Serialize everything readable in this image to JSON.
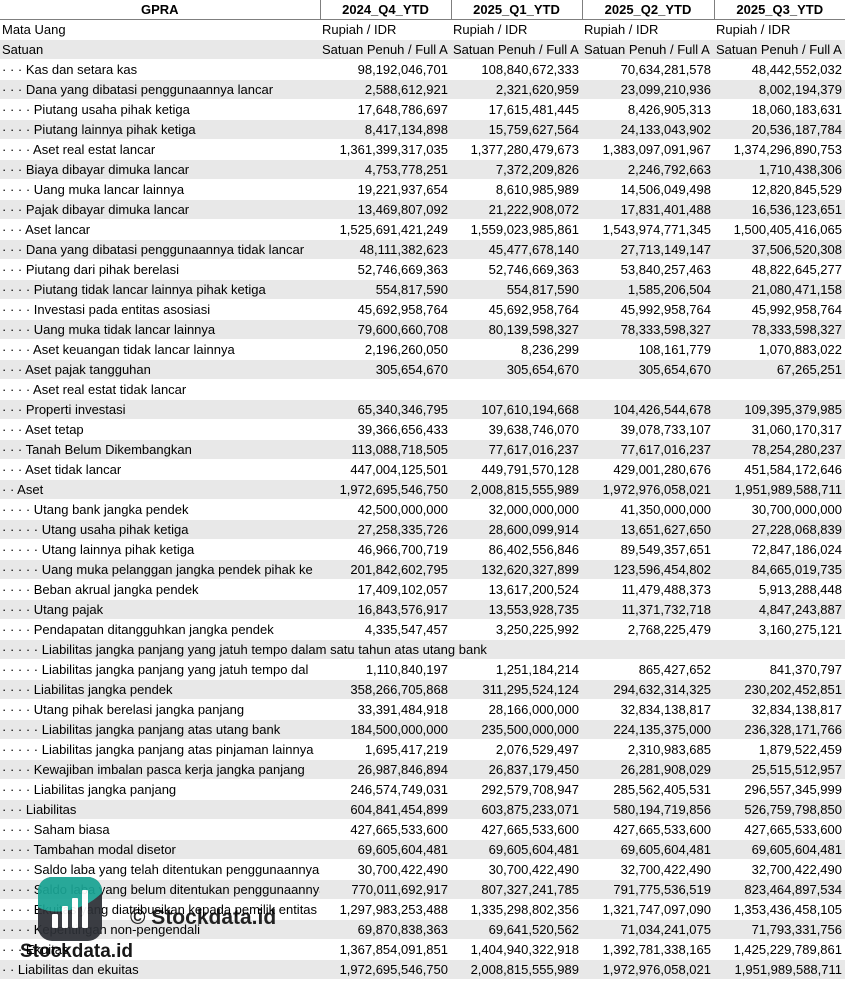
{
  "header": {
    "label": "GPRA",
    "periods": [
      "2024_Q4_YTD",
      "2025_Q1_YTD",
      "2025_Q2_YTD",
      "2025_Q3_YTD"
    ]
  },
  "meta_rows": [
    {
      "label": "Mata Uang",
      "values": [
        "Rupiah / IDR",
        "Rupiah / IDR",
        "Rupiah / IDR",
        "Rupiah / IDR"
      ]
    },
    {
      "label": "Satuan",
      "values": [
        "Satuan Penuh / Full A",
        "Satuan Penuh / Full A",
        "Satuan Penuh / Full A",
        "Satuan Penuh / Full A"
      ]
    }
  ],
  "rows": [
    {
      "indent": "· · · ",
      "label": "Kas dan setara kas",
      "values": [
        "98,192,046,701",
        "108,840,672,333",
        "70,634,281,578",
        "48,442,552,032"
      ]
    },
    {
      "indent": "· · · ",
      "label": "Dana yang dibatasi penggunaannya lancar",
      "values": [
        "2,588,612,921",
        "2,321,620,959",
        "23,099,210,936",
        "8,002,194,379"
      ]
    },
    {
      "indent": "· · · · ",
      "label": "Piutang usaha pihak ketiga",
      "values": [
        "17,648,786,697",
        "17,615,481,445",
        "8,426,905,313",
        "18,060,183,631"
      ]
    },
    {
      "indent": "· · · · ",
      "label": "Piutang lainnya pihak ketiga",
      "values": [
        "8,417,134,898",
        "15,759,627,564",
        "24,133,043,902",
        "20,536,187,784"
      ]
    },
    {
      "indent": "· · · · ",
      "label": "Aset real estat lancar",
      "values": [
        "1,361,399,317,035",
        "1,377,280,479,673",
        "1,383,097,091,967",
        "1,374,296,890,753"
      ]
    },
    {
      "indent": "· · · ",
      "label": "Biaya dibayar dimuka lancar",
      "values": [
        "4,753,778,251",
        "7,372,209,826",
        "2,246,792,663",
        "1,710,438,306"
      ]
    },
    {
      "indent": "· · · · ",
      "label": "Uang muka lancar lainnya",
      "values": [
        "19,221,937,654",
        "8,610,985,989",
        "14,506,049,498",
        "12,820,845,529"
      ]
    },
    {
      "indent": "· · · ",
      "label": "Pajak dibayar dimuka lancar",
      "values": [
        "13,469,807,092",
        "21,222,908,072",
        "17,831,401,488",
        "16,536,123,651"
      ]
    },
    {
      "indent": "· · · ",
      "label": "Aset lancar",
      "values": [
        "1,525,691,421,249",
        "1,559,023,985,861",
        "1,543,974,771,345",
        "1,500,405,416,065"
      ]
    },
    {
      "indent": "· · · ",
      "label": "Dana yang dibatasi penggunaannya tidak lancar",
      "values": [
        "48,111,382,623",
        "45,477,678,140",
        "27,713,149,147",
        "37,506,520,308"
      ]
    },
    {
      "indent": "· · · ",
      "label": "Piutang dari pihak berelasi",
      "values": [
        "52,746,669,363",
        "52,746,669,363",
        "53,840,257,463",
        "48,822,645,277"
      ]
    },
    {
      "indent": "· · · · ",
      "label": "Piutang tidak lancar lainnya pihak ketiga",
      "values": [
        "554,817,590",
        "554,817,590",
        "1,585,206,504",
        "21,080,471,158"
      ]
    },
    {
      "indent": "· · · · ",
      "label": "Investasi pada entitas asosiasi",
      "values": [
        "45,692,958,764",
        "45,692,958,764",
        "45,992,958,764",
        "45,992,958,764"
      ]
    },
    {
      "indent": "· · · · ",
      "label": "Uang muka tidak lancar lainnya",
      "values": [
        "79,600,660,708",
        "80,139,598,327",
        "78,333,598,327",
        "78,333,598,327"
      ]
    },
    {
      "indent": "· · · · ",
      "label": "Aset keuangan tidak lancar lainnya",
      "values": [
        "2,196,260,050",
        "8,236,299",
        "108,161,779",
        "1,070,883,022"
      ]
    },
    {
      "indent": "· · · ",
      "label": "Aset pajak tangguhan",
      "values": [
        "305,654,670",
        "305,654,670",
        "305,654,670",
        "67,265,251"
      ]
    },
    {
      "indent": "· · · · ",
      "label": "Aset real estat tidak lancar",
      "values": [
        "",
        "",
        "",
        ""
      ]
    },
    {
      "indent": "· · · ",
      "label": "Properti investasi",
      "values": [
        "65,340,346,795",
        "107,610,194,668",
        "104,426,544,678",
        "109,395,379,985"
      ]
    },
    {
      "indent": "· · · ",
      "label": "Aset tetap",
      "values": [
        "39,366,656,433",
        "39,638,746,070",
        "39,078,733,107",
        "31,060,170,317"
      ]
    },
    {
      "indent": "· · · ",
      "label": "Tanah Belum Dikembangkan",
      "values": [
        "113,088,718,505",
        "77,617,016,237",
        "77,617,016,237",
        "78,254,280,237"
      ]
    },
    {
      "indent": "· · · ",
      "label": "Aset tidak lancar",
      "values": [
        "447,004,125,501",
        "449,791,570,128",
        "429,001,280,676",
        "451,584,172,646"
      ]
    },
    {
      "indent": "· · ",
      "label": "Aset",
      "values": [
        "1,972,695,546,750",
        "2,008,815,555,989",
        "1,972,976,058,021",
        "1,951,989,588,711"
      ]
    },
    {
      "indent": "· · · · ",
      "label": "Utang bank jangka pendek",
      "values": [
        "42,500,000,000",
        "32,000,000,000",
        "41,350,000,000",
        "30,700,000,000"
      ]
    },
    {
      "indent": "· · · · · ",
      "label": "Utang usaha pihak ketiga",
      "values": [
        "27,258,335,726",
        "28,600,099,914",
        "13,651,627,650",
        "27,228,068,839"
      ]
    },
    {
      "indent": "· · · · · ",
      "label": "Utang lainnya pihak ketiga",
      "values": [
        "46,966,700,719",
        "86,402,556,846",
        "89,549,357,651",
        "72,847,186,024"
      ]
    },
    {
      "indent": "· · · · · ",
      "label": "Uang muka pelanggan jangka pendek pihak ke",
      "values": [
        "201,842,602,795",
        "132,620,327,899",
        "123,596,454,802",
        "84,665,019,735"
      ]
    },
    {
      "indent": "· · · · ",
      "label": "Beban akrual jangka pendek",
      "values": [
        "17,409,102,057",
        "13,617,200,524",
        "11,479,488,373",
        "5,913,288,448"
      ]
    },
    {
      "indent": "· · · · ",
      "label": "Utang pajak",
      "values": [
        "16,843,576,917",
        "13,553,928,735",
        "11,371,732,718",
        "4,847,243,887"
      ]
    },
    {
      "indent": "· · · · ",
      "label": "Pendapatan ditangguhkan jangka pendek",
      "values": [
        "4,335,547,457",
        "3,250,225,992",
        "2,768,225,479",
        "3,160,275,121"
      ]
    },
    {
      "indent": "· · · · · ",
      "label": "Liabilitas jangka panjang yang jatuh tempo dalam satu tahun atas utang bank",
      "values": [
        "",
        "",
        "",
        ""
      ],
      "span": true
    },
    {
      "indent": "· · · · · ",
      "label": "Liabilitas jangka panjang yang jatuh tempo dal",
      "values": [
        "1,110,840,197",
        "1,251,184,214",
        "865,427,652",
        "841,370,797"
      ]
    },
    {
      "indent": "· · · · ",
      "label": "Liabilitas jangka pendek",
      "values": [
        "358,266,705,868",
        "311,295,524,124",
        "294,632,314,325",
        "230,202,452,851"
      ]
    },
    {
      "indent": "· · · · ",
      "label": "Utang pihak berelasi jangka panjang",
      "values": [
        "33,391,484,918",
        "28,166,000,000",
        "32,834,138,817",
        "32,834,138,817"
      ]
    },
    {
      "indent": "· · · · · ",
      "label": "Liabilitas jangka panjang atas utang bank",
      "values": [
        "184,500,000,000",
        "235,500,000,000",
        "224,135,375,000",
        "236,328,171,766"
      ]
    },
    {
      "indent": "· · · · · ",
      "label": "Liabilitas jangka panjang atas pinjaman lainnya",
      "values": [
        "1,695,417,219",
        "2,076,529,497",
        "2,310,983,685",
        "1,879,522,459"
      ]
    },
    {
      "indent": "· · · · ",
      "label": "Kewajiban imbalan pasca kerja jangka panjang",
      "values": [
        "26,987,846,894",
        "26,837,179,450",
        "26,281,908,029",
        "25,515,512,957"
      ]
    },
    {
      "indent": "· · · · ",
      "label": "Liabilitas jangka panjang",
      "values": [
        "246,574,749,031",
        "292,579,708,947",
        "285,562,405,531",
        "296,557,345,999"
      ]
    },
    {
      "indent": "· · · ",
      "label": "Liabilitas",
      "values": [
        "604,841,454,899",
        "603,875,233,071",
        "580,194,719,856",
        "526,759,798,850"
      ]
    },
    {
      "indent": "· · · · ",
      "label": "Saham biasa",
      "values": [
        "427,665,533,600",
        "427,665,533,600",
        "427,665,533,600",
        "427,665,533,600"
      ]
    },
    {
      "indent": "· · · · ",
      "label": "Tambahan modal disetor",
      "values": [
        "69,605,604,481",
        "69,605,604,481",
        "69,605,604,481",
        "69,605,604,481"
      ]
    },
    {
      "indent": "· · · · ",
      "label": "Saldo laba yang telah ditentukan penggunaannya",
      "values": [
        "30,700,422,490",
        "30,700,422,490",
        "32,700,422,490",
        "32,700,422,490"
      ]
    },
    {
      "indent": "· · · · ",
      "label": "Saldo laba yang belum ditentukan penggunaannya",
      "values": [
        "770,011,692,917",
        "807,327,241,785",
        "791,775,536,519",
        "823,464,897,534"
      ]
    },
    {
      "indent": "· · · · ",
      "label": "Ekuitas yang diatribusikan kepada pemilik entitas",
      "values": [
        "1,297,983,253,488",
        "1,335,298,802,356",
        "1,321,747,097,090",
        "1,353,436,458,105"
      ]
    },
    {
      "indent": "· · · · ",
      "label": "Kepentingan non-pengendali",
      "values": [
        "69,870,838,363",
        "69,641,520,562",
        "71,034,241,075",
        "71,793,331,756"
      ]
    },
    {
      "indent": "· · · ",
      "label": "Ekuitas",
      "values": [
        "1,367,854,091,851",
        "1,404,940,322,918",
        "1,392,781,338,165",
        "1,425,229,789,861"
      ]
    },
    {
      "indent": "· · ",
      "label": "Liabilitas dan ekuitas",
      "values": [
        "1,972,695,546,750",
        "2,008,815,555,989",
        "1,972,976,058,021",
        "1,951,989,588,711"
      ]
    }
  ],
  "watermark": {
    "text": "© Stockdata.id",
    "brand": "Stockdata.id",
    "icon": "stockdata-logo-icon"
  },
  "colors": {
    "shade": "#e8e8e8",
    "logo_bg": "#2d3036",
    "logo_accent": "#18b8a4"
  }
}
